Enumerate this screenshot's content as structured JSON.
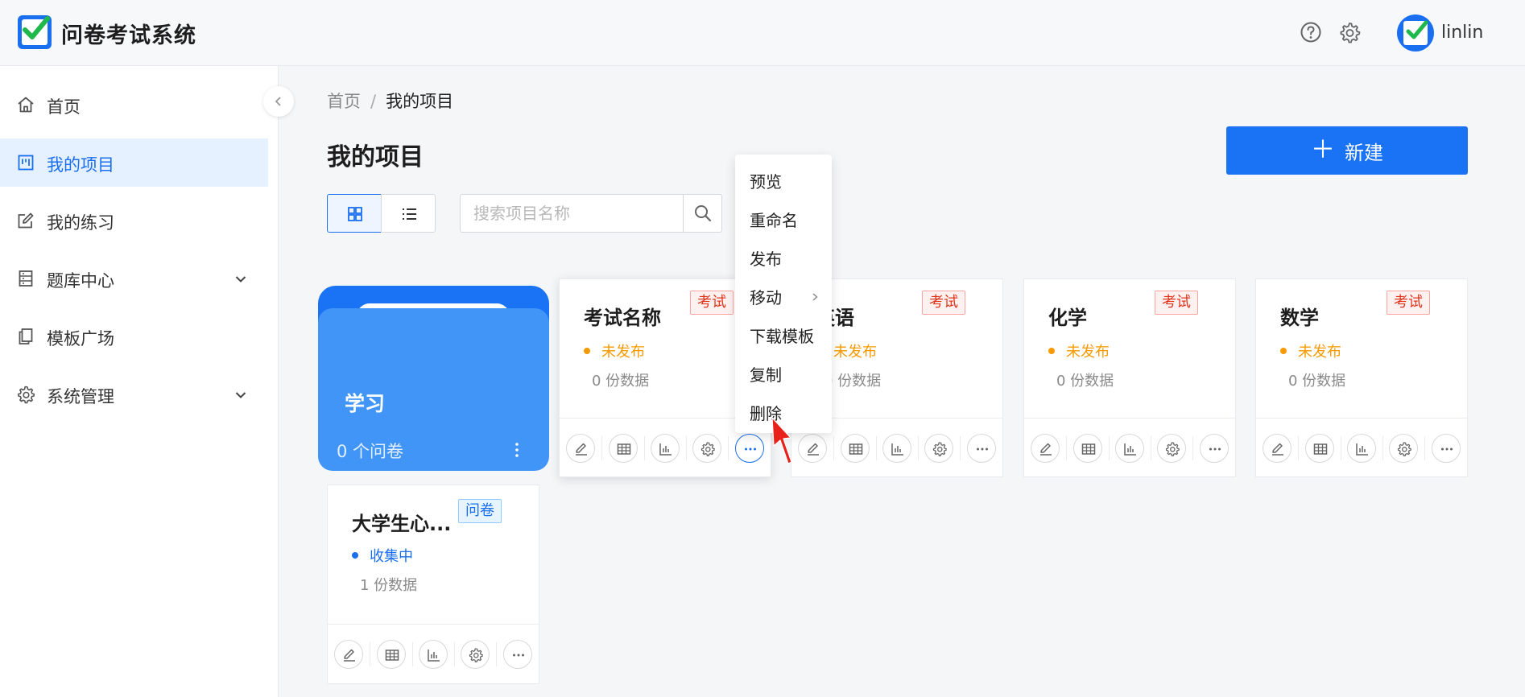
{
  "app": {
    "title": "问卷考试系统"
  },
  "user": {
    "name": "linlin"
  },
  "sidebar": {
    "items": [
      {
        "label": "首页"
      },
      {
        "label": "我的项目"
      },
      {
        "label": "我的练习"
      },
      {
        "label": "题库中心"
      },
      {
        "label": "模板广场"
      },
      {
        "label": "系统管理"
      }
    ]
  },
  "breadcrumb": {
    "home": "首页",
    "separator": "/",
    "current": "我的项目"
  },
  "page": {
    "title": "我的项目"
  },
  "toolbar": {
    "new_label": "新建",
    "new_plus": "＋"
  },
  "search": {
    "placeholder": "搜索项目名称",
    "value": ""
  },
  "folder": {
    "name": "学习",
    "count": "0 个问卷"
  },
  "cards": [
    {
      "title": "考试名称",
      "tag": "考试",
      "status": "未发布",
      "data": "0  份数据"
    },
    {
      "title": "英语",
      "tag": "考试",
      "status": "未发布",
      "data": "0  份数据"
    },
    {
      "title": "化学",
      "tag": "考试",
      "status": "未发布",
      "data": "0  份数据"
    },
    {
      "title": "数学",
      "tag": "考试",
      "status": "未发布",
      "data": "0  份数据"
    },
    {
      "title": "大学生心...",
      "tag": "问卷",
      "status": "收集中",
      "data": "1  份数据"
    }
  ],
  "menu": {
    "items": [
      {
        "label": "预览"
      },
      {
        "label": "重命名"
      },
      {
        "label": "发布"
      },
      {
        "label": "移动"
      },
      {
        "label": "下载模板"
      },
      {
        "label": "复制"
      },
      {
        "label": "删除"
      }
    ]
  },
  "colors": {
    "primary": "#1a73f5",
    "status_unpublished": "#f59a00",
    "status_collecting": "#1a6ff0",
    "tag_exam": "#e0341b",
    "tag_survey": "#1a6ff0"
  },
  "icons": [
    "help-icon",
    "gear-icon",
    "home-icon",
    "project-icon",
    "edit-icon",
    "bank-icon",
    "template-icon",
    "settings-icon",
    "chevron-down-icon",
    "chevron-left-icon",
    "grid-icon",
    "list-icon",
    "search-icon",
    "more-icon",
    "table-icon",
    "chart-icon",
    "chevron-right-icon"
  ]
}
